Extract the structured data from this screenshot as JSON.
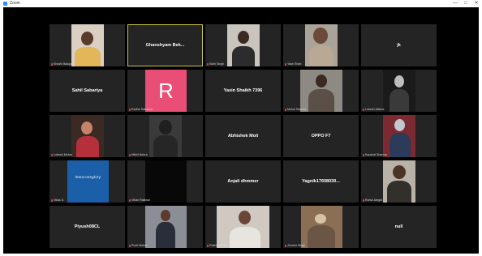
{
  "window": {
    "title": "Zoom",
    "controls": [
      "—",
      "□",
      "✕"
    ]
  },
  "colors": {
    "background": "#000000",
    "tile": "#242424",
    "active_border": "#c9c34a",
    "avatar_r": "#e94e77"
  },
  "participants": [
    {
      "label": "Khushi Baluja"
    },
    {
      "name": "Ghanshyam Bek..."
    },
    {
      "label": "Sidhi Singh"
    },
    {
      "label": "Yash Shah"
    },
    {
      "name": "jk"
    },
    {
      "name": "Sahil Sabariya"
    },
    {
      "label": "Radhe Sabariya",
      "avatar": "R"
    },
    {
      "name": "Yasin Shaikh 7396"
    },
    {
      "label": "Mukul Sharma"
    },
    {
      "label": "Lokesh Mishra"
    },
    {
      "label": "Lohesh Meher"
    },
    {
      "label": "Nikhil Nehra"
    },
    {
      "name": "Abhishek Moli"
    },
    {
      "name": "OPPO F7"
    },
    {
      "label": "Kaushal Sharma"
    },
    {
      "label": "Vikas S.",
      "logo": "letscrossglory"
    },
    {
      "label": "Vihan Raikwar"
    },
    {
      "name": "Anjali dhmmer"
    },
    {
      "name": "Yagnik17608030..."
    },
    {
      "label": "Rahul Jangid"
    },
    {
      "name": "Piyush08CL"
    },
    {
      "label": "Punit Mehra"
    },
    {
      "label": "Rakhi Parekh"
    },
    {
      "label": "Jhumer Singh"
    },
    {
      "name": "null"
    }
  ]
}
